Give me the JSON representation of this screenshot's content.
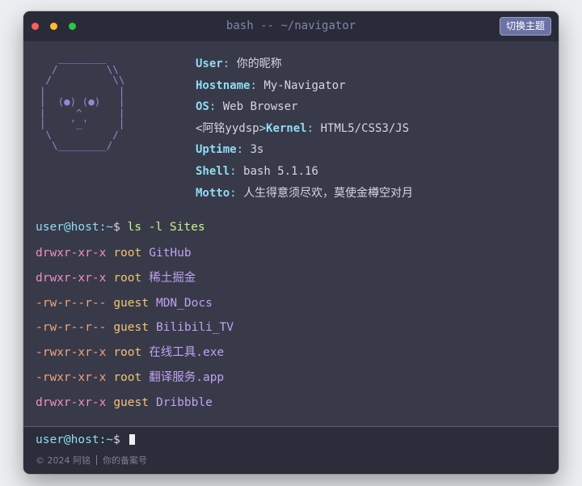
{
  "window": {
    "title": "bash -- ~/navigator",
    "theme_button": "切换主题"
  },
  "ascii_art": "   ________\n  /        \\\\\n /          \\\\\n|            |\n|  (●) (●)   |\n|     ^      |\n|    '_'     |\n \\          /\n  \\________/",
  "info": [
    {
      "prefix": "",
      "key": "User",
      "value": "你的昵称"
    },
    {
      "prefix": "",
      "key": "Hostname",
      "value": "My-Navigator"
    },
    {
      "prefix": "",
      "key": "OS",
      "value": "Web Browser"
    },
    {
      "prefix": "<阿铭yydsp>",
      "key": "Kernel",
      "value": "HTML5/CSS3/JS"
    },
    {
      "prefix": "",
      "key": "Uptime",
      "value": "3s"
    },
    {
      "prefix": "",
      "key": "Shell",
      "value": "bash 5.1.16"
    },
    {
      "prefix": "",
      "key": "Motto",
      "value": "人生得意须尽欢，莫使金樽空对月"
    }
  ],
  "prompt": {
    "user": "user@host",
    "path": ":~",
    "dollar": "$",
    "command": "ls -l Sites"
  },
  "listing": [
    {
      "perm": "drwxr-xr-x",
      "perm_type": "dir",
      "owner": "root",
      "name": "GitHub"
    },
    {
      "perm": "drwxr-xr-x",
      "perm_type": "dir",
      "owner": "root",
      "name": "稀土掘金"
    },
    {
      "perm": "-rw-r--r--",
      "perm_type": "file",
      "owner": "guest",
      "name": "MDN_Docs"
    },
    {
      "perm": "-rw-r--r--",
      "perm_type": "file",
      "owner": "guest",
      "name": "Bilibili_TV"
    },
    {
      "perm": "-rwxr-xr-x",
      "perm_type": "file",
      "owner": "root",
      "name": "在线工具.exe"
    },
    {
      "perm": "-rwxr-xr-x",
      "perm_type": "file",
      "owner": "root",
      "name": "翻译服务.app"
    },
    {
      "perm": "drwxr-xr-x",
      "perm_type": "dir",
      "owner": "guest",
      "name": "Dribbble"
    }
  ],
  "footer": {
    "prompt_user": "user@host",
    "prompt_path": ":~",
    "prompt_dollar": "$",
    "copyright": "© 2024 阿铭",
    "icp": "你的备案号"
  },
  "colors": {
    "background": "#383a4a",
    "titlebar": "#2a2b38",
    "key": "#8fdcf2",
    "command": "#c6f68d",
    "dir_perm": "#f08fc1",
    "file_perm": "#f3a477",
    "owner": "#f5c46e",
    "name": "#bfa3f0"
  }
}
